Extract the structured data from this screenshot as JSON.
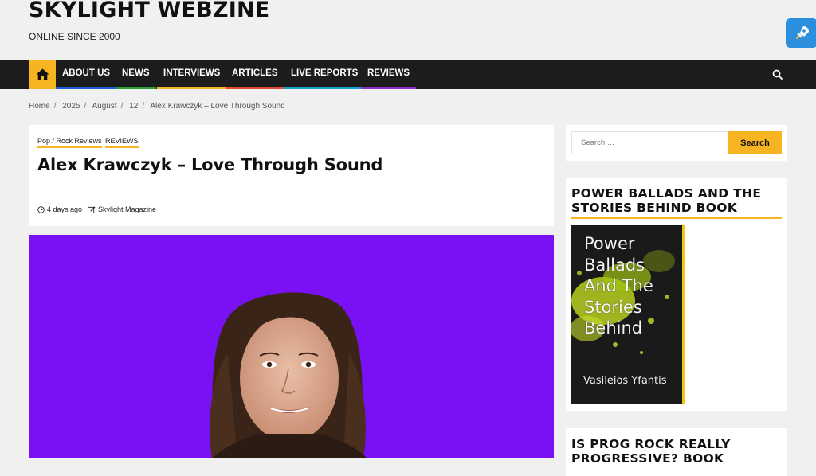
{
  "site": {
    "title": "SKYLIGHT WEBZINE",
    "tagline": "ONLINE SINCE 2000"
  },
  "nav": {
    "home_icon": "home-icon",
    "items": [
      {
        "label": "ABOUT US",
        "color": "#1a5fd6"
      },
      {
        "label": "NEWS",
        "color": "#2e9c33"
      },
      {
        "label": "INTERVIEWS",
        "color": "#f7b422"
      },
      {
        "label": "ARTICLES",
        "color": "#e5482c"
      },
      {
        "label": "LIVE REPORTS",
        "color": "#13a2c9"
      },
      {
        "label": "REVIEWS",
        "color": "#8b2fc9"
      }
    ],
    "search_icon": "search-icon"
  },
  "breadcrumb": [
    "Home",
    "2025",
    "August",
    "12",
    "Alex Krawczyk – Love Through Sound"
  ],
  "article": {
    "categories": [
      "Pop / Rock Reviews",
      "REVIEWS"
    ],
    "title": "Alex Krawczyk – Love Through Sound",
    "date": "4 days ago",
    "author": "Skylight Magazine",
    "hero_bg": "#7a10f4"
  },
  "sidebar": {
    "search": {
      "placeholder": "Search …",
      "button": "Search"
    },
    "widgets": [
      {
        "title": "POWER BALLADS AND THE STORIES BEHIND BOOK",
        "book": {
          "title_lines": [
            "Power",
            "Ballads",
            "And The",
            "Stories",
            "Behind"
          ],
          "author": "Vasileios Yfantis"
        }
      },
      {
        "title": "IS PROG ROCK REALLY PROGRESSIVE? BOOK"
      }
    ]
  },
  "colors": {
    "accent": "#f7b422",
    "nav_bg": "#1c1c1c",
    "rocket_bg": "#2b8fe0"
  }
}
